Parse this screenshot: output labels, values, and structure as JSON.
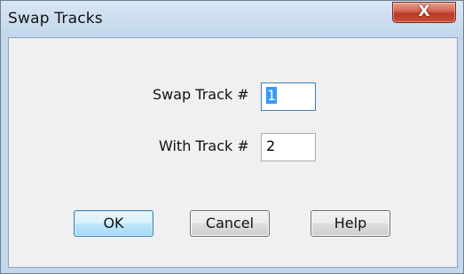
{
  "window": {
    "title": "Swap Tracks",
    "close_glyph": "X"
  },
  "form": {
    "swap_label": "Swap Track #",
    "swap_value": "1",
    "with_label": "With Track #",
    "with_value": "2"
  },
  "buttons": {
    "ok": "OK",
    "cancel": "Cancel",
    "help": "Help"
  }
}
